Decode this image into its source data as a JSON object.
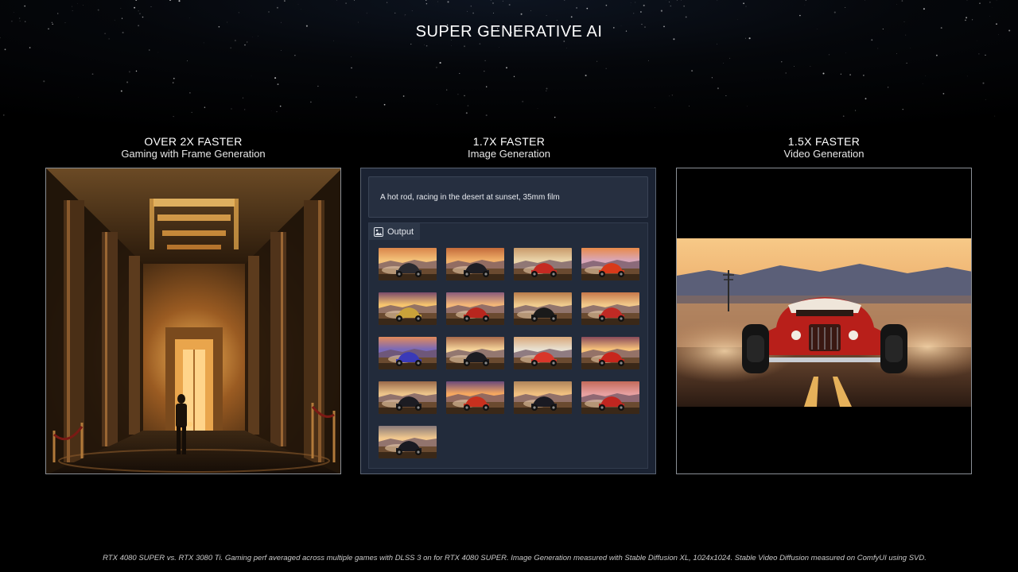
{
  "slide": {
    "title": "SUPER GENERATIVE AI",
    "footnote": "RTX 4080 SUPER vs. RTX 3080 Ti.  Gaming perf averaged across multiple games with DLSS 3 on for RTX 4080 SUPER. Image Generation measured with Stable Diffusion XL, 1024x1024.  Stable Video Diffusion measured on ComfyUI using SVD."
  },
  "columns": [
    {
      "headline": "OVER 2X FASTER",
      "subtitle": "Gaming with Frame Generation",
      "image": "game-hall-scene"
    },
    {
      "headline": "1.7X FASTER",
      "subtitle": "Image Generation",
      "image": "image-generation-ui"
    },
    {
      "headline": "1.5X FASTER",
      "subtitle": "Video Generation",
      "image": "hot-rod-video-frame"
    }
  ],
  "image_generation": {
    "prompt": "A hot rod, racing in the desert at sunset, 35mm film",
    "output_label": "Output",
    "output_icon": "image-icon",
    "thumbnail_count": 17
  },
  "colors": {
    "background": "#000000",
    "panel_border": "#8a8f96",
    "ui_panel": "#1b2333",
    "ui_surface": "#222b3b"
  }
}
